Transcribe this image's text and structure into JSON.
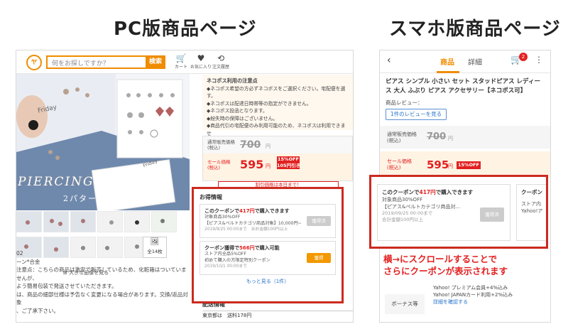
{
  "headings": {
    "pc": "PC版商品ページ",
    "sp": "スマホ版商品ページ"
  },
  "pc": {
    "header": {
      "logo": "ヤ",
      "search_placeholder": "何をお探しですか？",
      "search_button": "検索",
      "icons": [
        {
          "icon": "cart-icon",
          "glyph": "🛒",
          "label": "カート"
        },
        {
          "icon": "heart-icon",
          "glyph": "♥",
          "label": "お気に入り"
        },
        {
          "icon": "history-icon",
          "glyph": "⟲",
          "label": "注文履歴"
        }
      ]
    },
    "hero": {
      "friday": "Friday",
      "piercing": "PIERCING",
      "pattern": "2パターン",
      "friday2": "Friday"
    },
    "thumbs": {
      "more_count": "全14枚",
      "more_icon": "🖼",
      "enlarge": "⊞ 大きな画像を見る"
    },
    "lower_text": [
      "02",
      "ーン*合金",
      "注意点：こちらの商品は激安で販売しているため、化粧箱はついていませんが、",
      "よう簡易包装で発送させていただきます。",
      "は、商品の細部仕様は予告なく変更になる場合があります。交換/返品対象",
      "、ご了承下さい。"
    ],
    "notice": {
      "title": "ネコポス利用の注意点",
      "lines": [
        "◆ネコポス希望の方必ずネコポスをご選択ください。宅配便を選",
        "す。",
        "◆ネコポスは配達日時帯等の指定ができません。",
        "◆ネコポス投函となります。",
        "◆紛失時の保障はございません。",
        "◆商品代引の宅配便のみ利用可能のため、ネコポスは利用できませ"
      ]
    },
    "price": {
      "normal_label": "通常販売価格\n(税込)",
      "normal_value": "700",
      "yen": "円",
      "sale_label": "セール価格\n(税込)",
      "sale_value": "595",
      "off_badge": "15%OFF\n105円引き",
      "discount_note": "割引価格は本日まで！"
    },
    "coupons": {
      "title": "お得情報",
      "items": [
        {
          "head_pre": "このクーポンで",
          "head_amount": "417円",
          "head_post": "で購入できます",
          "desc1": "対象商品30%OFF",
          "desc2": "【ピアス&ベルトカテゴリ商品対象】10,000円~",
          "date": "2019/9/25 00:00まで　合計金額100円以上",
          "button": "獲得済",
          "state": "done"
        },
        {
          "head_pre": "クーポン獲得で",
          "head_amount": "566円",
          "head_post": "で購入可能",
          "desc1": "ストア内全品5%OFF",
          "desc2": "初めて購入の方限定特別クーポン",
          "date": "2019/10/1 00:00まで",
          "button": "獲得",
          "state": "get"
        }
      ],
      "more": "もっと見る（1件）"
    },
    "delivery": {
      "title": "配送情報",
      "line": "東京都は　送料178円"
    }
  },
  "sp": {
    "topbar": {
      "back": "‹",
      "tab_product": "商品",
      "tab_detail": "詳細",
      "cart_count": "2",
      "menu": "⋮"
    },
    "title": "ピアス シンプル 小さい セット スタッドピアス レディース 大人 ふぶり ピアス アクセサリー【ネコポス可】",
    "review_label": "商品レビュー：",
    "review_button": "1件のレビューを見る",
    "price": {
      "normal_label": "通常販売価格\n(税込)",
      "normal_value": "700",
      "yen": "円",
      "sale_label": "セール価格\n(税込)",
      "sale_value": "595",
      "off_badge": "15%OFF"
    },
    "coupons": [
      {
        "head_pre": "このクーポンで",
        "head_amount": "417円",
        "head_post": "で購入できます",
        "desc1": "対象商品30%OFF",
        "desc2": "【ピアス&ベルトカテゴリ商品対...",
        "date1": "2019/09/25 00:00まで",
        "date2": "合計金額100円以上",
        "button": "獲得済"
      },
      {
        "head_pre": "クーポン",
        "desc1": "ストア内",
        "desc2": "Yahoo!ア"
      }
    ],
    "bonus": {
      "label": "ボーナス等",
      "line1": "Yahoo! プレミアム会員+4%込み",
      "line2": "Yahoo! JAPANカード利用+2%込み",
      "link": "詳細を確認する"
    }
  },
  "annotation": "横→にスクロールすることで\nさらにクーポンが表示されます",
  "colors": {
    "accent": "#f08c00",
    "sale_red": "#e32020",
    "highlight_border": "#cc2a1f",
    "link": "#2672c9"
  }
}
